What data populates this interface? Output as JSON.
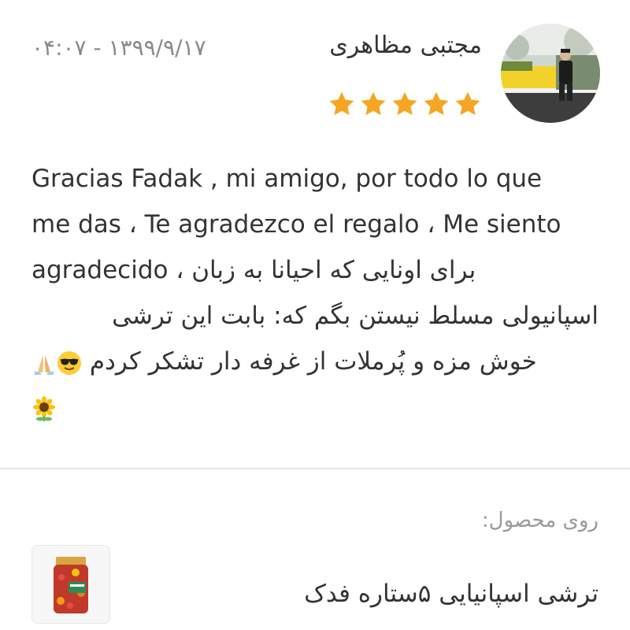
{
  "review": {
    "author": {
      "name": "مجتبی مظاهری",
      "avatar_icon": "user-photo-avatar"
    },
    "date": "۰۴:۰۷ - ۱۳۹۹/۹/۱۷",
    "rating": {
      "value": 5,
      "max": 5,
      "star_color": "#f5a623"
    },
    "text_lines": [
      "Gracias Fadak , mi amigo, por todo lo que",
      "me das ، Te agradezco el regalo ، Me siento",
      "agradecido ، برای اونایی که احیانا به زبان",
      "اسپانیولی مسلط نیستن بگم که: بابت این ترشی",
      "خوش مزه و پُرملات از غرفه دار تشکر کردم",
      ""
    ],
    "emojis": [
      "sunglasses-emoji",
      "folded-hands-emoji",
      "sunflower-emoji"
    ]
  },
  "product": {
    "caption": "روی محصول:",
    "name": "ترشی اسپانیایی ۵ستاره فدک",
    "thumb_icon": "pickle-jar-image"
  },
  "colors": {
    "text": "#333333",
    "muted": "#8a8a8a",
    "star": "#f5a623",
    "divider": "#e6e6e6"
  }
}
